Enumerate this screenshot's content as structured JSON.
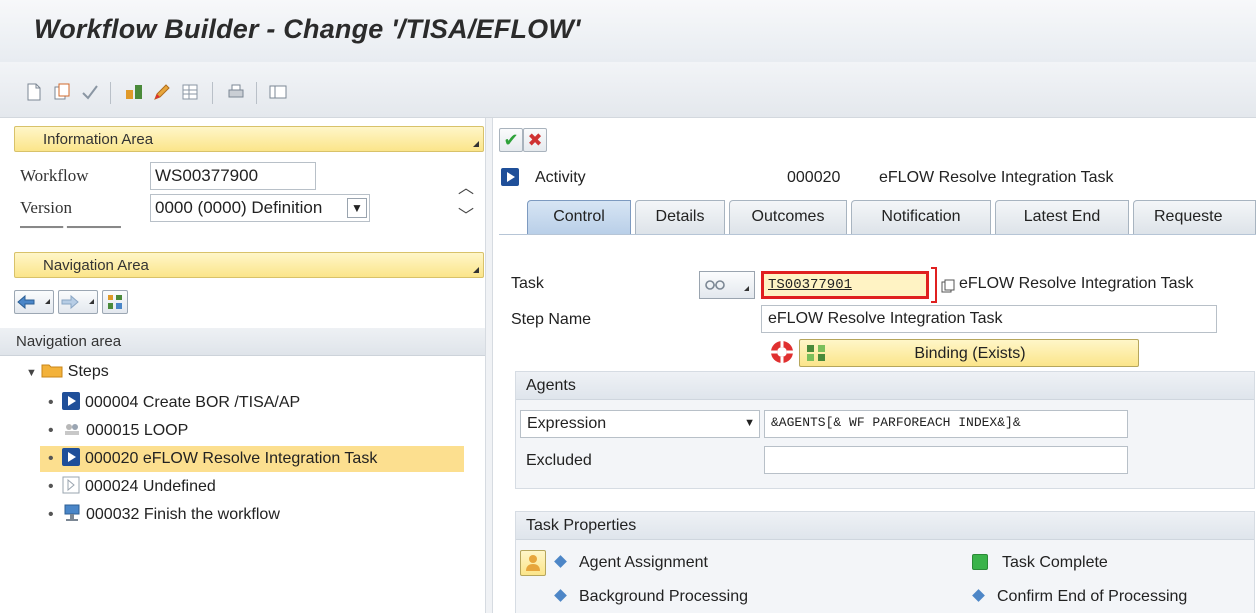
{
  "window": {
    "title": "Workflow Builder - Change '/TISA/EFLOW'"
  },
  "toolbar": {
    "icons": [
      "new-document-icon",
      "copy-icon",
      "check-icon",
      "workflow-icon",
      "pencil-icon",
      "table-icon",
      "print-icon",
      "layout-icon"
    ]
  },
  "info_area": {
    "label": "Information Area",
    "workflow_label": "Workflow",
    "workflow_value": "WS00377900",
    "version_label": "Version",
    "version_value": "0000 (0000) Definition"
  },
  "nav_area": {
    "label": "Navigation Area",
    "header": "Navigation area",
    "tree": {
      "root": "Steps",
      "items": [
        {
          "text": "000004 Create BOR /TISA/AP",
          "icon": "activity-icon"
        },
        {
          "text": "000015 LOOP",
          "icon": "loop-icon"
        },
        {
          "text": "000020 eFLOW Resolve Integration Task",
          "icon": "activity-icon",
          "selected": true
        },
        {
          "text": "000024 Undefined",
          "icon": "undefined-step-icon"
        },
        {
          "text": "000032 Finish the workflow",
          "icon": "finish-icon"
        }
      ]
    }
  },
  "detail": {
    "step_type": "Activity",
    "step_number": "000020",
    "step_title": "eFLOW Resolve Integration Task",
    "tabs": [
      "Control",
      "Details",
      "Outcomes",
      "Notification",
      "Latest End",
      "Requeste"
    ],
    "task_label": "Task",
    "task_value": "TS00377901",
    "task_description": "eFLOW Resolve Integration Task",
    "step_name_label": "Step Name",
    "step_name_value": "eFLOW Resolve Integration Task",
    "binding_label": "Binding (Exists)",
    "agents": {
      "title": "Agents",
      "type_value": "Expression",
      "expression_value": "&AGENTS[& WF PARFOREACH INDEX&]&",
      "excluded_label": "Excluded",
      "excluded_value": ""
    },
    "task_properties": {
      "title": "Task Properties",
      "agent_assignment": "Agent Assignment",
      "background_processing": "Background Processing",
      "task_complete": "Task Complete",
      "confirm_end": "Confirm End of Processing"
    }
  },
  "colors": {
    "highlight": "#e02020",
    "selection": "#fcdf8f",
    "area_bar": "#fbe58a",
    "tab_active": "#b9cfe8"
  }
}
